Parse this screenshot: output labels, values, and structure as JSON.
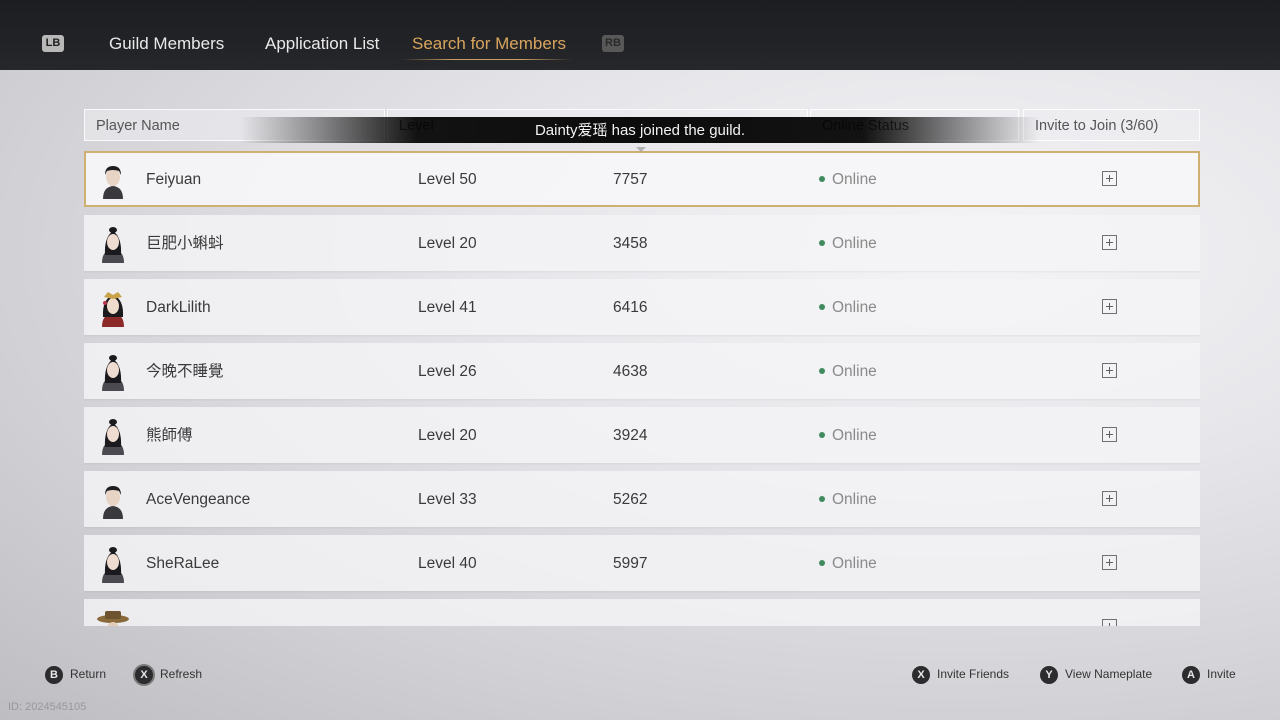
{
  "tabs": {
    "lb": "LB",
    "rb": "RB",
    "items": [
      {
        "label": "Guild Members"
      },
      {
        "label": "Application List"
      },
      {
        "label": "Search for Members"
      }
    ],
    "active": "Search for Members"
  },
  "table": {
    "headers": {
      "player_name": "Player Name",
      "level": "Level",
      "online_status": "Online Status",
      "invite": "Invite to Join (3/60)"
    },
    "rows": [
      {
        "name": "Feiyuan",
        "level": "Level 50",
        "power": "7757",
        "status": "Online",
        "avatar": "male-avatar"
      },
      {
        "name": "巨肥小蝌蚪",
        "level": "Level 20",
        "power": "3458",
        "status": "Online",
        "avatar": "female-avatar"
      },
      {
        "name": "DarkLilith",
        "level": "Level 41",
        "power": "6416",
        "status": "Online",
        "avatar": "ornate-female-avatar"
      },
      {
        "name": "今晚不睡覺",
        "level": "Level 26",
        "power": "4638",
        "status": "Online",
        "avatar": "female-avatar"
      },
      {
        "name": "熊師傅",
        "level": "Level 20",
        "power": "3924",
        "status": "Online",
        "avatar": "female-avatar"
      },
      {
        "name": "AceVengeance",
        "level": "Level 33",
        "power": "5262",
        "status": "Online",
        "avatar": "male-avatar"
      },
      {
        "name": "SheRaLee",
        "level": "Level 40",
        "power": "5997",
        "status": "Online",
        "avatar": "female-avatar"
      }
    ],
    "status_color": "#3f8a5e",
    "selected_border_color": "#cfb073"
  },
  "toast": {
    "message": "Dainty爱瑶 has joined the guild."
  },
  "footer": {
    "return": {
      "key": "B",
      "label": "Return"
    },
    "refresh": {
      "key": "X",
      "label": "Refresh"
    },
    "invite_friends": {
      "key": "X",
      "label": "Invite Friends"
    },
    "view_nameplate": {
      "key": "Y",
      "label": "View Nameplate"
    },
    "invite": {
      "key": "A",
      "label": "Invite"
    }
  },
  "watermark": "ID: 2024545105",
  "colors": {
    "accent": "#d9a55e",
    "topbar": "#1c1d20"
  }
}
